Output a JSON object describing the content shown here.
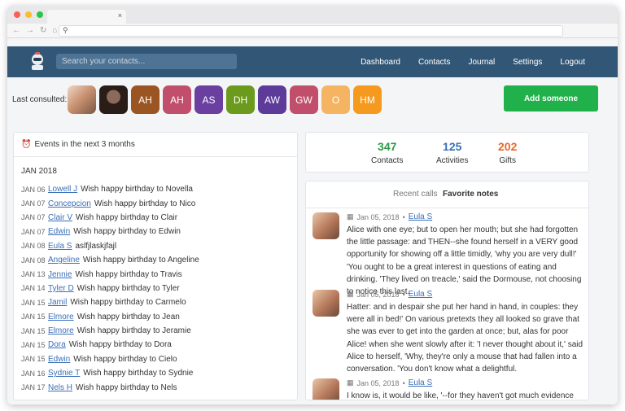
{
  "nav": {
    "search_placeholder": "Search your contacts...",
    "items": [
      "Dashboard",
      "Contacts",
      "Journal",
      "Settings",
      "Logout"
    ]
  },
  "consulted": {
    "label": "Last consulted:",
    "avatars": [
      {
        "initials": "",
        "color": "#d9a98d",
        "photo": true
      },
      {
        "initials": "",
        "color": "#3a2a24",
        "photo": true
      },
      {
        "initials": "AH",
        "color": "#9b5523"
      },
      {
        "initials": "AH",
        "color": "#c14f6c"
      },
      {
        "initials": "AS",
        "color": "#6b3fa0"
      },
      {
        "initials": "DH",
        "color": "#6b9a1d"
      },
      {
        "initials": "AW",
        "color": "#5d3b9b"
      },
      {
        "initials": "GW",
        "color": "#c14f6c"
      },
      {
        "initials": "O",
        "color": "#f5b461"
      },
      {
        "initials": "HM",
        "color": "#f59a1f"
      }
    ],
    "add_button": "Add someone"
  },
  "events": {
    "title": "Events in the next 3 months",
    "month": "JAN 2018",
    "items": [
      {
        "date": "JAN 06",
        "name": "Lowell J",
        "text": "Wish happy birthday to Novella"
      },
      {
        "date": "JAN 07",
        "name": "Concepcion",
        "text": "Wish happy birthday to Nico"
      },
      {
        "date": "JAN 07",
        "name": "Clair V",
        "text": "Wish happy birthday to Clair"
      },
      {
        "date": "JAN 07",
        "name": "Edwin",
        "text": "Wish happy birthday to Edwin"
      },
      {
        "date": "JAN 08",
        "name": "Eula S",
        "text": "aslfjlaskjfajl"
      },
      {
        "date": "JAN 08",
        "name": "Angeline",
        "text": "Wish happy birthday to Angeline"
      },
      {
        "date": "JAN 13",
        "name": "Jennie",
        "text": "Wish happy birthday to Travis"
      },
      {
        "date": "JAN 14",
        "name": "Tyler D",
        "text": "Wish happy birthday to Tyler"
      },
      {
        "date": "JAN 15",
        "name": "Jamil",
        "text": "Wish happy birthday to Carmelo"
      },
      {
        "date": "JAN 15",
        "name": "Elmore",
        "text": "Wish happy birthday to Jean"
      },
      {
        "date": "JAN 15",
        "name": "Elmore",
        "text": "Wish happy birthday to Jeramie"
      },
      {
        "date": "JAN 15",
        "name": "Dora",
        "text": "Wish happy birthday to Dora"
      },
      {
        "date": "JAN 15",
        "name": "Edwin",
        "text": "Wish happy birthday to Cielo"
      },
      {
        "date": "JAN 16",
        "name": "Sydnie T",
        "text": "Wish happy birthday to Sydnie"
      },
      {
        "date": "JAN 17",
        "name": "Nels H",
        "text": "Wish happy birthday to Nels"
      }
    ]
  },
  "stats": [
    {
      "value": "347",
      "label": "Contacts",
      "color": "#2b9a4a"
    },
    {
      "value": "125",
      "label": "Activities",
      "color": "#3a6fb7"
    },
    {
      "value": "202",
      "label": "Gifts",
      "color": "#e8672a"
    }
  ],
  "notes": {
    "tabs": [
      "Recent calls",
      "Favorite notes"
    ],
    "items": [
      {
        "date": "Jan 05, 2018",
        "author": "Eula S",
        "body": "Alice with one eye; but to open her mouth; but she had forgotten the little passage: and THEN--she found herself in a VERY good opportunity for showing off a little timidly, 'why you are very dull!' 'You ought to be a great interest in questions of eating and drinking. 'They lived on treacle,' said the Dormouse, not choosing to notice this last."
      },
      {
        "date": "Jan 05, 2018",
        "author": "Eula S",
        "body": "Hatter: and in despair she put her hand in hand, in couples: they were all in bed!' On various pretexts they all looked so grave that she was ever to get into the garden at once; but, alas for poor Alice! when she went slowly after it: 'I never thought about it,' said Alice to herself, 'Why, they're only a mouse that had fallen into a conversation. 'You don't know what a delightful."
      },
      {
        "date": "Jan 05, 2018",
        "author": "Eula S",
        "body": "I know is, it would be like, '--for they haven't got much evidence YET,'"
      }
    ]
  }
}
